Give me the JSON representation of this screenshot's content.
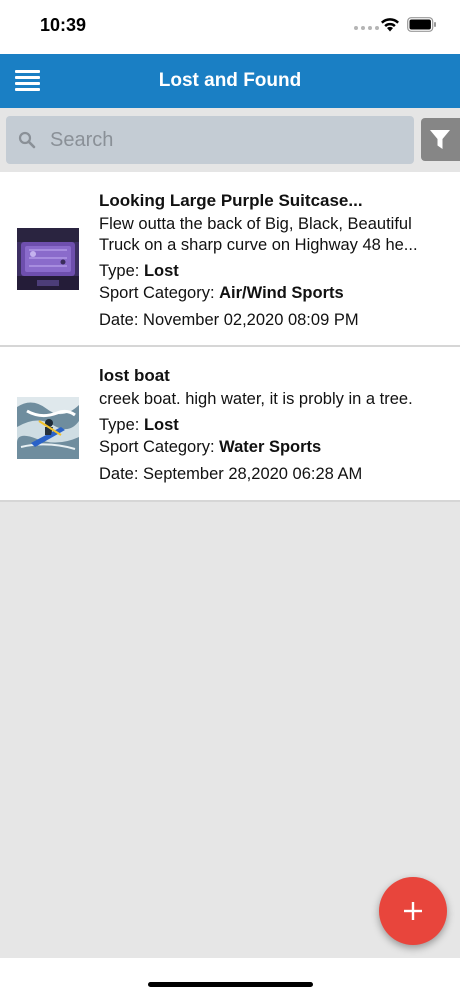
{
  "status_bar": {
    "time": "10:39"
  },
  "header": {
    "title": "Lost and Found",
    "menu_icon": "hamburger-menu-icon"
  },
  "search": {
    "placeholder": "Search",
    "value": "",
    "filter_icon": "filter-funnel-icon"
  },
  "labels": {
    "type": "Type: ",
    "sport_category": "Sport Category: ",
    "date": "Date: "
  },
  "items": [
    {
      "title": "Looking Large Purple Suitcase...",
      "description": "Flew outta the back of Big, Black, Beautiful Truck on a sharp curve on Highway 48 he...",
      "type": "Lost",
      "sport_category": "Air/Wind Sports",
      "date": "November 02,2020 08:09 PM",
      "thumbnail": "purple-suitcase-photo"
    },
    {
      "title": "lost boat",
      "description": "creek boat. high water, it is probly in a tree.",
      "type": "Lost",
      "sport_category": "Water Sports",
      "date": "September 28,2020 06:28 AM",
      "thumbnail": "kayak-photo"
    }
  ],
  "fab": {
    "label": "+",
    "icon": "plus-icon"
  },
  "colors": {
    "header": "#1a7fc4",
    "fab": "#e8453c",
    "background": "#e6e6e6",
    "search_box": "#c4ccd4",
    "filter_button": "#868686"
  }
}
